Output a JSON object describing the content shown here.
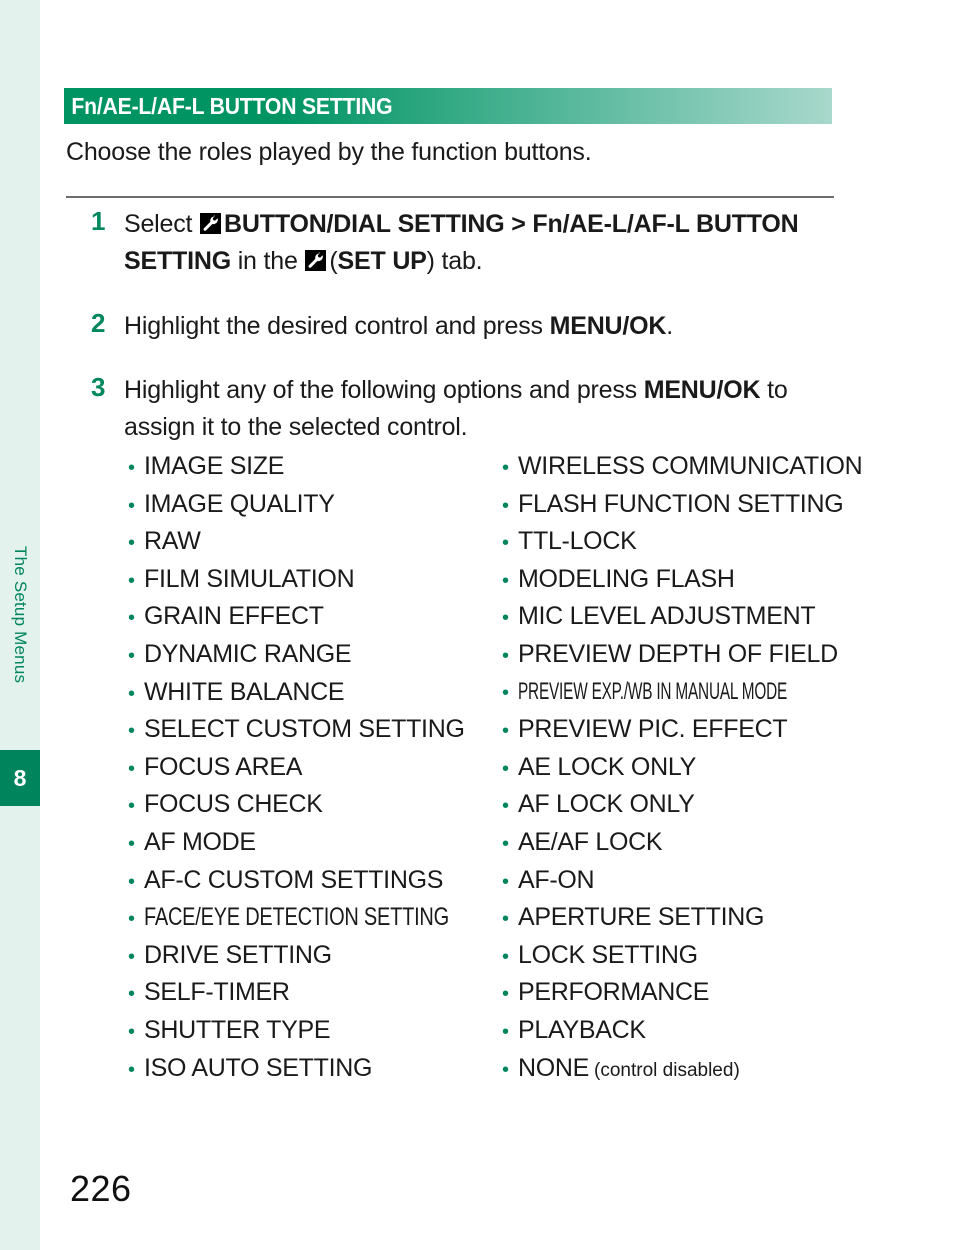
{
  "sidebar": {
    "chapter_label": "The Setup Menus",
    "chapter_number": "8",
    "rail_color": "#e4f2ee",
    "tab_color": "#00845c"
  },
  "header": {
    "title": "Fn/AE-L/AF-L BUTTON SETTING",
    "gradient_from": "#009463",
    "gradient_to": "#a8d8cb"
  },
  "intro": "Choose the roles played by the function buttons.",
  "steps": [
    {
      "number": "1",
      "icon": "wrench-tab-icon",
      "text_parts": {
        "lead": "Select",
        "bold_path_1": "BUTTON/DIAL",
        "bold_path_2": "SETTING",
        "separator": ">",
        "bold_path_3": "Fn/AE-L/",
        "bold_path_4": "AF-L BUTTON SETTING",
        "middle": "in the",
        "bold_tab": "SET UP",
        "tail": "tab."
      }
    },
    {
      "number": "2",
      "text_parts": {
        "lead": "Highlight the desired control and press",
        "bold_key": "MENU/OK",
        "tail": "."
      }
    },
    {
      "number": "3",
      "text_parts": {
        "lead": "Highlight any of the following options and press",
        "bold_key": "MENU/OK",
        "tail": "to assign it to the selected control."
      }
    }
  ],
  "options": {
    "bullet_color": "#00855c",
    "left_column": [
      {
        "label": "IMAGE SIZE"
      },
      {
        "label": "IMAGE QUALITY"
      },
      {
        "label": "RAW"
      },
      {
        "label": "FILM SIMULATION"
      },
      {
        "label": "GRAIN EFFECT"
      },
      {
        "label": "DYNAMIC RANGE"
      },
      {
        "label": "WHITE BALANCE"
      },
      {
        "label": "SELECT CUSTOM SETTING"
      },
      {
        "label": "FOCUS AREA"
      },
      {
        "label": "FOCUS CHECK"
      },
      {
        "label": "AF MODE"
      },
      {
        "label": "AF-C CUSTOM SETTINGS"
      },
      {
        "label": "FACE/EYE DETECTION SETTING",
        "condensed": "squeeze"
      },
      {
        "label": "DRIVE SETTING"
      },
      {
        "label": "SELF-TIMER"
      },
      {
        "label": "SHUTTER TYPE"
      },
      {
        "label": "ISO AUTO SETTING"
      }
    ],
    "right_column": [
      {
        "label": "WIRELESS COMMUNICATION"
      },
      {
        "label": "FLASH FUNCTION SETTING"
      },
      {
        "label": "TTL-LOCK"
      },
      {
        "label": "MODELING FLASH"
      },
      {
        "label": "MIC LEVEL ADJUSTMENT"
      },
      {
        "label": "PREVIEW DEPTH OF FIELD"
      },
      {
        "label": "PREVIEW EXP./WB IN MANUAL MODE",
        "condensed": "squeeze2"
      },
      {
        "label": "PREVIEW PIC. EFFECT"
      },
      {
        "label": "AE LOCK ONLY"
      },
      {
        "label": "AF LOCK ONLY"
      },
      {
        "label": "AE/AF LOCK"
      },
      {
        "label": "AF-ON"
      },
      {
        "label": "APERTURE SETTING"
      },
      {
        "label": "LOCK SETTING"
      },
      {
        "label": "PERFORMANCE"
      },
      {
        "label": "PLAYBACK"
      },
      {
        "label": "NONE",
        "note": "(control disabled)"
      }
    ]
  },
  "page_number": "226"
}
